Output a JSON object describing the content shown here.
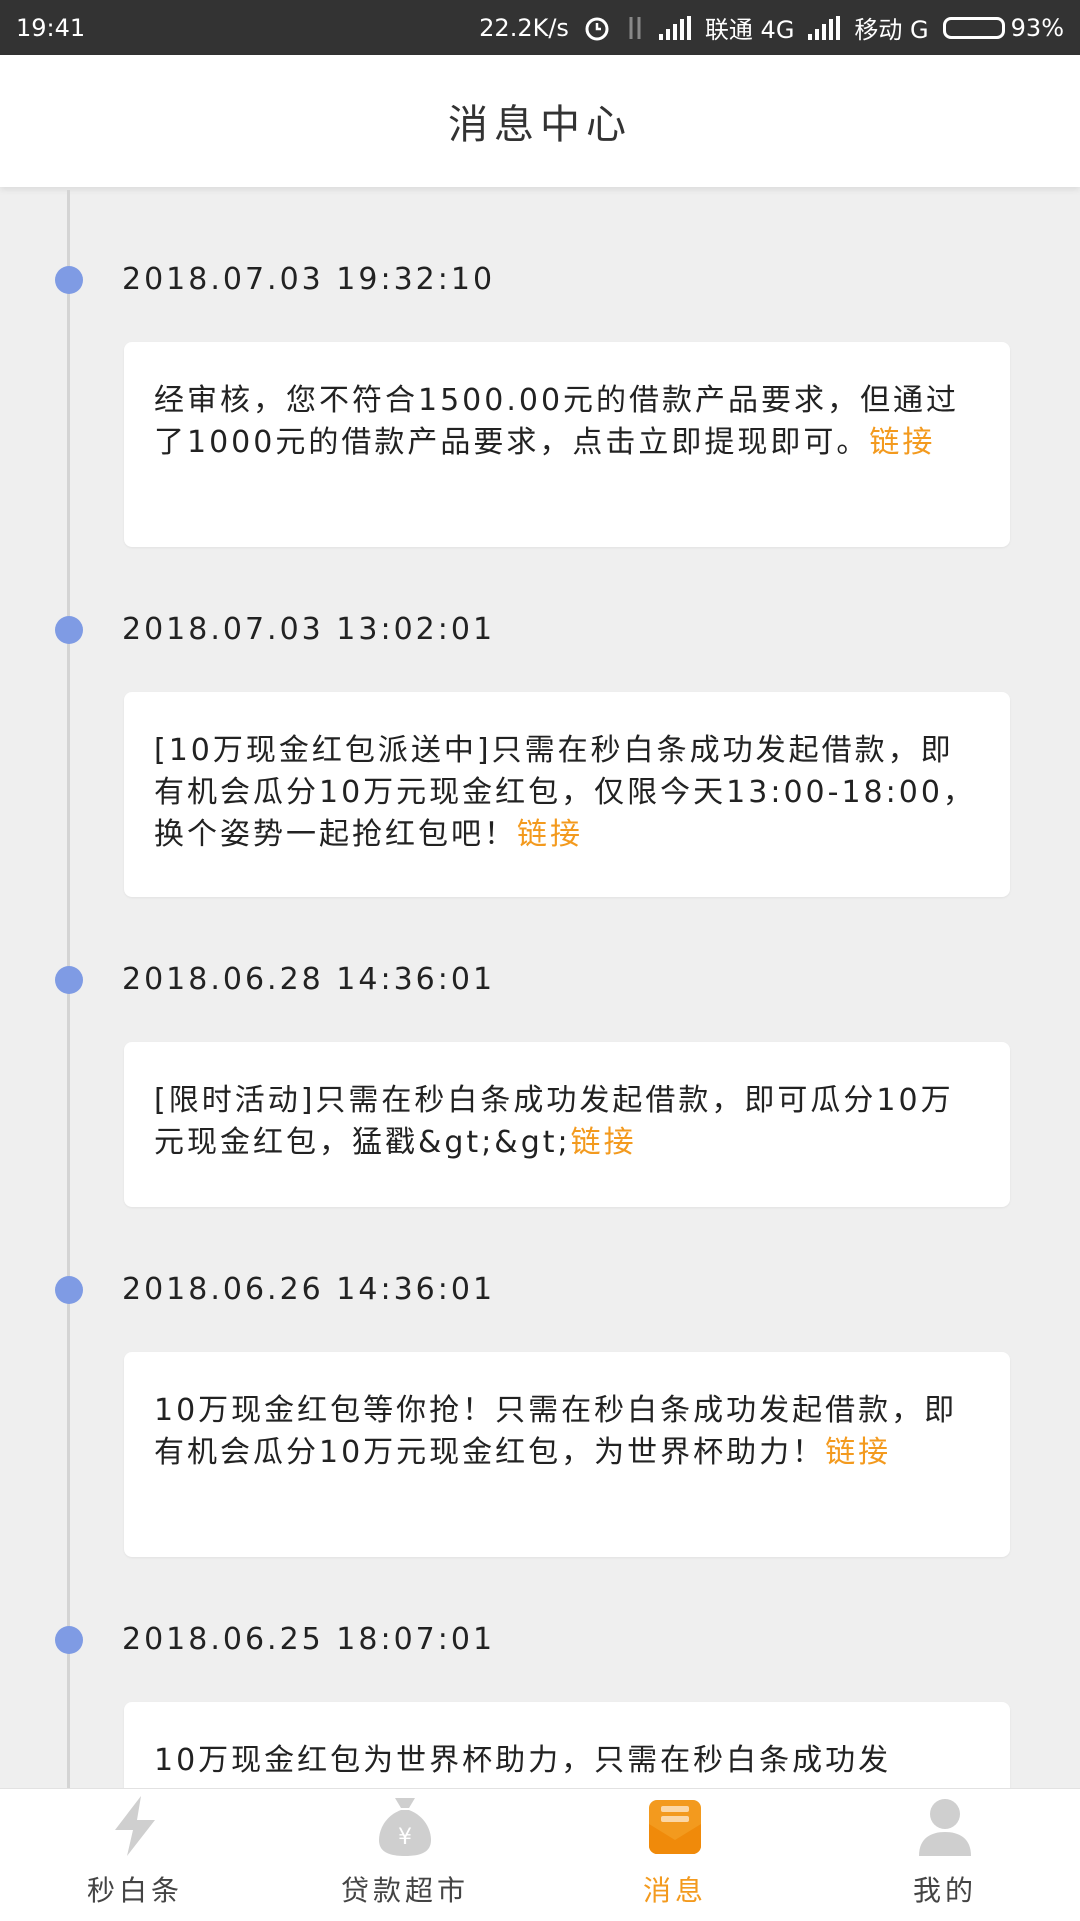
{
  "status_bar": {
    "time": "19:41",
    "speed": "22.2K/s",
    "carrier1": "联通 4G",
    "carrier2": "移动 G",
    "battery": "93%",
    "battery_level": 0.93
  },
  "header": {
    "title": "消息中心"
  },
  "messages": [
    {
      "time": "2018.07.03 19:32:10",
      "text": "经审核，您不符合1500.00元的借款产品要求，但通过了1000元的借款产品要求，点击立即提现即可。",
      "link": "链接"
    },
    {
      "time": "2018.07.03 13:02:01",
      "text": "[10万现金红包派送中]只需在秒白条成功发起借款，即有机会瓜分10万元现金红包，仅限今天13:00-18:00，换个姿势一起抢红包吧！",
      "link": "链接"
    },
    {
      "time": "2018.06.28 14:36:01",
      "text": "[限时活动]只需在秒白条成功发起借款，即可瓜分10万元现金红包，猛戳&gt;&gt;",
      "link": "链接"
    },
    {
      "time": "2018.06.26 14:36:01",
      "text": "10万现金红包等你抢！只需在秒白条成功发起借款，即有机会瓜分10万元现金红包，为世界杯助力！",
      "link": "链接"
    },
    {
      "time": "2018.06.25 18:07:01",
      "text": "10万现金红包为世界杯助力，只需在秒白条成功发",
      "link": ""
    }
  ],
  "nav": [
    {
      "label": "秒白条",
      "icon": "lightning-icon",
      "active": false
    },
    {
      "label": "贷款超市",
      "icon": "money-bag-icon",
      "active": false
    },
    {
      "label": "消息",
      "icon": "message-icon",
      "active": true
    },
    {
      "label": "我的",
      "icon": "user-icon",
      "active": false
    }
  ],
  "colors": {
    "accent": "#f39a1e",
    "timeline_dot": "#7f9be4",
    "background": "#efefef"
  }
}
